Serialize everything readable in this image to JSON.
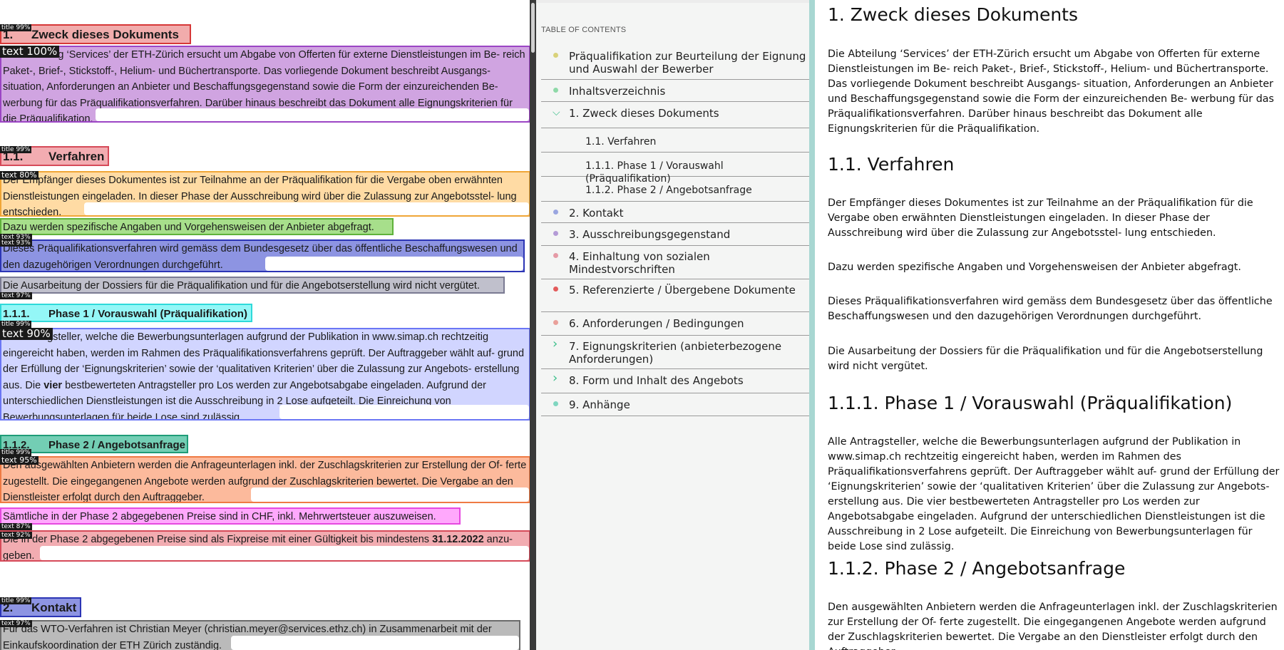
{
  "annotated": {
    "t1_num": "1.",
    "t1_text": "Zweck dieses Dokuments",
    "p1": "Die Abteilung ‘Services’ der ETH-Zürich ersucht um Abgabe von Offerten für externe Dienstleistungen im Be- reich Paket-, Brief-, Stickstoff-, Helium- und Büchertransporte. Das vorliegende Dokument beschreibt Ausgangs- situation, Anforderungen an Anbieter und Beschaffungsgegenstand sowie die Form der einzureichenden Be- werbung für das Präqualifikationsverfahren. Darüber hinaus beschreibt das Dokument alle Eignungskriterien für die Präqualifikation.",
    "t2_num": "1.1.",
    "t2_text": "Verfahren",
    "p2": "Der Empfänger dieses Dokumentes ist zur Teilnahme an der Präqualifikation für die Vergabe oben erwähnten Dienstleistungen eingeladen. In dieser Phase der Ausschreibung wird über die Zulassung zur Angebotsstel- lung entschieden.",
    "p3": "Dazu werden spezifische Angaben und Vorgehensweisen der Anbieter abgefragt.",
    "p4": "Dieses Präqualifikationsverfahren wird gemäss dem Bundesgesetz über das öffentliche Beschaffungswesen und den dazugehörigen Verordnungen durchgeführt.",
    "p5": "Die Ausarbeitung der Dossiers für die Präqualifikation und für die Angebotserstellung wird nicht vergütet.",
    "t3_num": "1.1.1.",
    "t3_text": "Phase 1 / Vorauswahl (Präqualifikation)",
    "p6a": "Alle Antragsteller, welche die Bewerbungsunterlagen aufgrund der Publikation in www.simap.ch rechtzeitig eingereicht haben, werden im Rahmen des Präqualifikationsverfahrens geprüft. Der Auftraggeber wählt auf- grund der Erfüllung der ‘Eignungskriterien’ sowie der ‘qualitativen Kriterien’ über die Zulassung zur Angebots- erstellung aus. Die ",
    "p6_bold": "vier",
    "p6b": " bestbewerteten Antragsteller pro Los werden zur Angebotsabgabe eingeladen. Aufgrund der unterschiedlichen Dienstleistungen ist die Ausschreibung in 2 Lose aufgeteilt. Die Einreichung von Bewerbungsunterlagen für beide Lose sind zulässig.",
    "t4_num": "1.1.2.",
    "t4_text": "Phase 2 / Angebotsanfrage",
    "p7": "Den ausgewählten Anbietern werden die Anfrageunterlagen inkl. der Zuschlagskriterien zur Erstellung der Of- ferte zugestellt. Die eingegangenen Angebote werden aufgrund der Zuschlagskriterien bewertet. Die Vergabe an den Dienstleister erfolgt durch den Auftraggeber.",
    "p8": "Sämtliche in der Phase 2 abgegebenen Preise sind in CHF, inkl. Mehrwertsteuer auszuweisen.",
    "p9a": "Die in der Phase 2 abgegebenen Preise sind als Fixpreise mit einer Gültigkeit bis mindestens ",
    "p9_bold": "31.12.2022",
    "p9b": " anzu- geben.",
    "t5_num": "2.",
    "t5_text": "Kontakt",
    "p10": "Für das WTO-Verfahren ist Christian Meyer (christian.meyer@services.ethz.ch) in Zusammenarbeit mit der Einkaufskoordination der ETH Zürich zuständig.",
    "tags": {
      "t1": "title 99%",
      "p1": "text 100%",
      "t2": "title 99%",
      "p2": "text 80%",
      "p3": "text 93%",
      "p4": "text 93%",
      "p5": "text 97%",
      "t3": "title 99%",
      "p6": "text 90%",
      "t4": "title 99%",
      "p7": "text 95%",
      "p8": "text 87%",
      "p9": "text 92%",
      "t5": "title 99%",
      "p10": "text 97%"
    }
  },
  "toc": {
    "heading": "TABLE OF CONTENTS",
    "items": [
      {
        "label": "Präqualifikation zur Beurteilung der Eignung und Auswahl der Bewerber",
        "marker": "dot",
        "color": "#d9d27a"
      },
      {
        "label": "Inhaltsverzeichnis",
        "marker": "dot",
        "color": "#8fd9a8"
      },
      {
        "label": "1. Zweck dieses Dokuments",
        "marker": "chevron-down",
        "color": "#3bbf8a"
      },
      {
        "label": "1.1. Verfahren",
        "marker": "none"
      },
      {
        "label": "1.1.1. Phase 1 / Vorauswahl (Präqualifikation)",
        "marker": "none"
      },
      {
        "label": "1.1.2. Phase 2 / Angebotsanfrage",
        "marker": "none"
      },
      {
        "label": "2. Kontakt",
        "marker": "dot",
        "color": "#9aa6e0"
      },
      {
        "label": "3. Ausschreibungsgegenstand",
        "marker": "dot",
        "color": "#b49bd6"
      },
      {
        "label": "4. Einhaltung von sozialen Mindestvorschriften",
        "marker": "dot",
        "color": "#e59aa6"
      },
      {
        "label": "5. Referenzierte / Übergebene Dokumente",
        "marker": "dot",
        "color": "#e35b5b"
      },
      {
        "label": "6. Anforderungen / Bedingungen",
        "marker": "dot",
        "color": "#e9a09a"
      },
      {
        "label": "7. Eignungskriterien (anbieterbezogene Anforderungen)",
        "marker": "chevron-right",
        "color": "#3bbf8a"
      },
      {
        "label": "8. Form und Inhalt des Angebots",
        "marker": "chevron-right",
        "color": "#3bbf8a"
      },
      {
        "label": "9. Anhänge",
        "marker": "dot",
        "color": "#7fd6c0"
      }
    ]
  },
  "doc": {
    "h_zweck": "1. Zweck dieses Dokuments",
    "p_zweck": "Die Abteilung ‘Services’ der ETH-Zürich ersucht um Abgabe von Offerten für externe Dienstleistungen im Be- reich Paket-, Brief-, Stickstoff-, Helium- und Büchertransporte. Das vorliegende Dokument beschreibt Ausgangs- situation, Anforderungen an Anbieter und Beschaffungsgegenstand sowie die Form der einzureichenden Be- werbung für das Präqualifikationsverfahren. Darüber hinaus beschreibt das Dokument alle Eignungskriterien für die Präqualifikation.",
    "h_verfahren": "1.1. Verfahren",
    "p_verfahren1": "Der Empfänger dieses Dokumentes ist zur Teilnahme an der Präqualifikation für die Vergabe oben erwähnten Dienstleistungen eingeladen. In dieser Phase der Ausschreibung wird über die Zulassung zur Angebotsstel- lung entschieden.",
    "p_verfahren2": "Dazu werden spezifische Angaben und Vorgehensweisen der Anbieter abgefragt.",
    "p_verfahren3": "Dieses Präqualifikationsverfahren wird gemäss dem Bundesgesetz über das öffentliche Beschaffungswesen und den dazugehörigen Verordnungen durchgeführt.",
    "p_verfahren4": "Die Ausarbeitung der Dossiers für die Präqualifikation und für die Angebotserstellung wird nicht vergütet.",
    "h_phase1": "1.1.1. Phase 1 / Vorauswahl (Präqualifikation)",
    "p_phase1": "Alle Antragsteller, welche die Bewerbungsunterlagen aufgrund der Publikation in www.simap.ch rechtzeitig eingereicht haben, werden im Rahmen des Präqualifikationsverfahrens geprüft. Der Auftraggeber wählt auf- grund der Erfüllung der ‘Eignungskriterien’ sowie der ‘qualitativen Kriterien’ über die Zulassung zur Angebots- erstellung aus. Die vier bestbewerteten Antragsteller pro Los werden zur Angebotsabgabe eingeladen. Aufgrund der unterschiedlichen Dienstleistungen ist die Ausschreibung in 2 Lose aufgeteilt. Die Einreichung von Bewerbungsunterlagen für beide Lose sind zulässig.",
    "h_phase2": "1.1.2. Phase 2 / Angebotsanfrage",
    "p_phase2": "Den ausgewählten Anbietern werden die Anfrageunterlagen inkl. der Zuschlagskriterien zur Erstellung der Of- ferte zugestellt. Die eingegangenen Angebote werden aufgrund der Zuschlagskriterien bewertet. Die Vergabe an den Dienstleister erfolgt durch den Auftraggeber."
  }
}
